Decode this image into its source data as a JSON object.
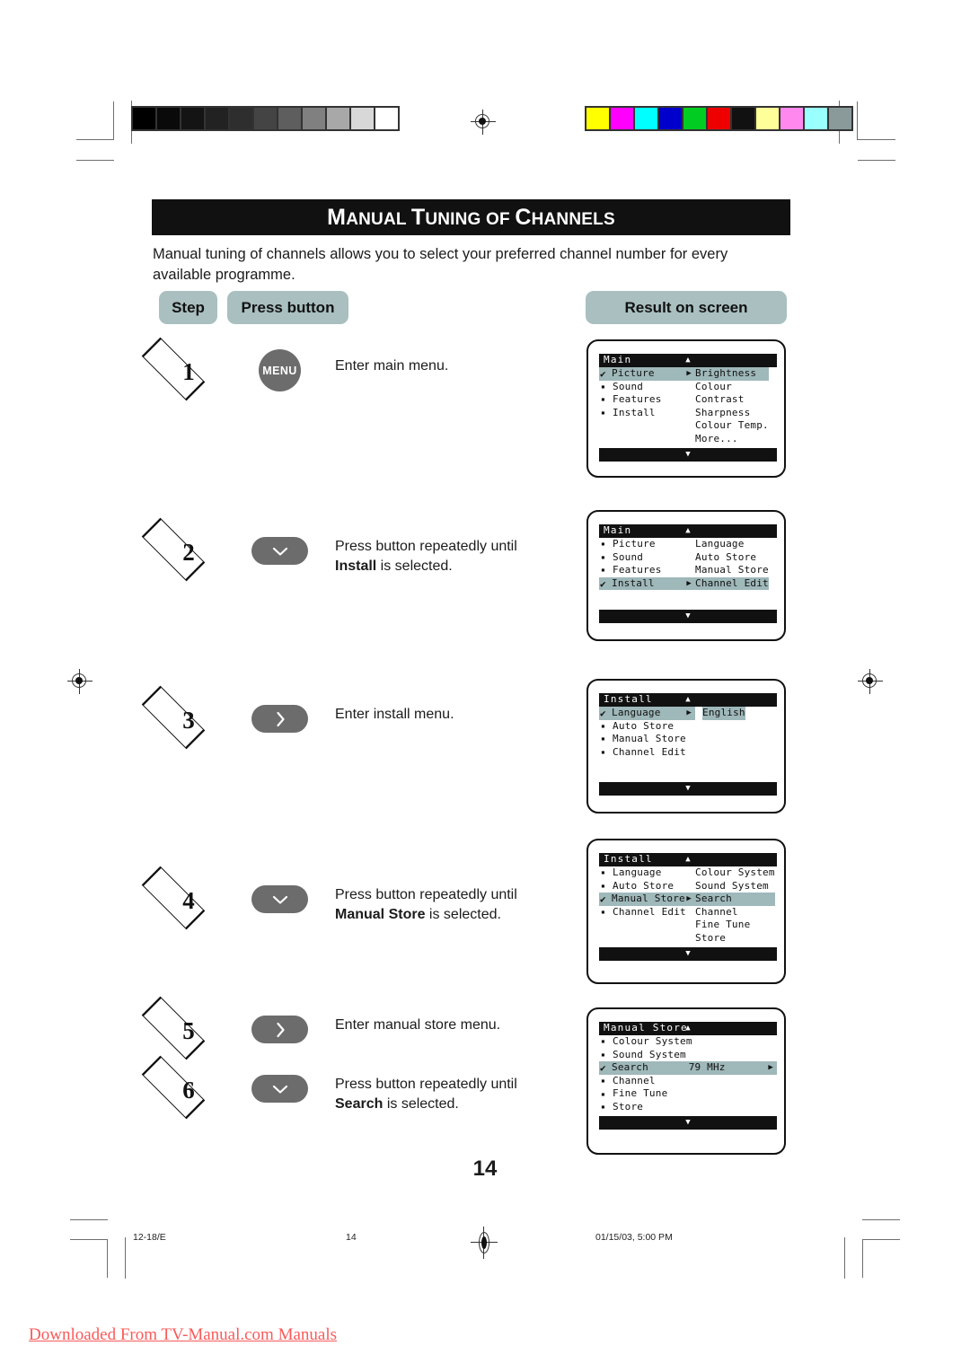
{
  "document": {
    "title_parts": [
      {
        "big": "M",
        "small": "ANUAL"
      },
      {
        "big": "T",
        "small": "UNING"
      },
      {
        "big": "",
        "small": "OF"
      },
      {
        "big": "C",
        "small": "HANNELS"
      }
    ],
    "title_text": "MANUAL TUNING OF CHANNELS",
    "intro": "Manual tuning of channels allows you to select your preferred channel number for every available programme.",
    "page_number": "14"
  },
  "headers": {
    "step": "Step",
    "press_button": "Press button",
    "result_on_screen": "Result on screen",
    "pill_color": "#a9bfc0"
  },
  "steps": [
    {
      "number": "1",
      "button": {
        "type": "round",
        "label": "MENU",
        "icon": "menu-button"
      },
      "text_plain": "Enter main menu.",
      "text_bold": "",
      "text_tail": ""
    },
    {
      "number": "2",
      "button": {
        "type": "pill",
        "label": "",
        "icon": "chevron-down-icon"
      },
      "text_plain": "Press button repeatedly until ",
      "text_bold": "Install",
      "text_tail": " is selected."
    },
    {
      "number": "3",
      "button": {
        "type": "pill",
        "label": "",
        "icon": "chevron-right-icon"
      },
      "text_plain": "Enter install menu.",
      "text_bold": "",
      "text_tail": ""
    },
    {
      "number": "4",
      "button": {
        "type": "pill",
        "label": "",
        "icon": "chevron-down-icon"
      },
      "text_plain": "Press button repeatedly until ",
      "text_bold": "Manual Store",
      "text_tail": " is selected."
    },
    {
      "number": "5",
      "button": {
        "type": "pill",
        "label": "",
        "icon": "chevron-right-icon"
      },
      "text_plain": "Enter manual store menu.",
      "text_bold": "",
      "text_tail": ""
    },
    {
      "number": "6",
      "button": {
        "type": "pill",
        "label": "",
        "icon": "chevron-down-icon"
      },
      "text_plain": "Press button repeatedly until ",
      "text_bold": "Search",
      "text_tail": " is selected."
    }
  ],
  "screens": [
    {
      "title": "Main",
      "up_arrow": "▲",
      "down_arrow": "▼",
      "left_items": [
        {
          "marker": "check",
          "label": "Picture",
          "selected": true,
          "arrow": "▶"
        },
        {
          "marker": "square",
          "label": "Sound",
          "selected": false,
          "arrow": ""
        },
        {
          "marker": "square",
          "label": "Features",
          "selected": false,
          "arrow": ""
        },
        {
          "marker": "square",
          "label": "Install",
          "selected": false,
          "arrow": ""
        }
      ],
      "right_items": [
        {
          "label": "Brightness",
          "selected": true
        },
        {
          "label": "Colour",
          "selected": false
        },
        {
          "label": "Contrast",
          "selected": false
        },
        {
          "label": "Sharpness",
          "selected": false
        },
        {
          "label": "Colour Temp.",
          "selected": false
        },
        {
          "label": "More...",
          "selected": false
        }
      ]
    },
    {
      "title": "Main",
      "up_arrow": "▲",
      "down_arrow": "▼",
      "left_items": [
        {
          "marker": "square",
          "label": "Picture",
          "selected": false,
          "arrow": ""
        },
        {
          "marker": "square",
          "label": "Sound",
          "selected": false,
          "arrow": ""
        },
        {
          "marker": "square",
          "label": "Features",
          "selected": false,
          "arrow": ""
        },
        {
          "marker": "check",
          "label": "Install",
          "selected": true,
          "arrow": "▶"
        }
      ],
      "right_items": [
        {
          "label": "Language",
          "selected": false
        },
        {
          "label": "Auto Store",
          "selected": false
        },
        {
          "label": "Manual Store",
          "selected": false
        },
        {
          "label": "Channel Edit",
          "selected": true
        }
      ]
    },
    {
      "title": "Install",
      "up_arrow": "▲",
      "down_arrow": "▼",
      "left_items": [
        {
          "marker": "check",
          "label": "Language",
          "selected": true,
          "arrow": "▶"
        },
        {
          "marker": "square",
          "label": "Auto Store",
          "selected": false,
          "arrow": ""
        },
        {
          "marker": "square",
          "label": "Manual Store",
          "selected": false,
          "arrow": ""
        },
        {
          "marker": "square",
          "label": "Channel Edit",
          "selected": false,
          "arrow": ""
        }
      ],
      "right_items": [
        {
          "label": "English",
          "selected": true
        }
      ]
    },
    {
      "title": "Install",
      "up_arrow": "▲",
      "down_arrow": "▼",
      "left_items": [
        {
          "marker": "square",
          "label": "Language",
          "selected": false,
          "arrow": ""
        },
        {
          "marker": "square",
          "label": "Auto Store",
          "selected": false,
          "arrow": ""
        },
        {
          "marker": "check",
          "label": "Manual Store",
          "selected": true,
          "arrow": "▶"
        },
        {
          "marker": "square",
          "label": "Channel Edit",
          "selected": false,
          "arrow": ""
        }
      ],
      "right_items": [
        {
          "label": "Colour System",
          "selected": false
        },
        {
          "label": "Sound System",
          "selected": false
        },
        {
          "label": "Search",
          "selected": true
        },
        {
          "label": "Channel",
          "selected": false
        },
        {
          "label": "Fine Tune",
          "selected": false
        },
        {
          "label": "Store",
          "selected": false
        }
      ]
    },
    {
      "title": "Manual Store",
      "up_arrow": "▲",
      "down_arrow": "▼",
      "left_items": [
        {
          "marker": "square",
          "label": "Colour System",
          "selected": false,
          "arrow": "",
          "value": ""
        },
        {
          "marker": "square",
          "label": "Sound System",
          "selected": false,
          "arrow": "",
          "value": ""
        },
        {
          "marker": "check",
          "label": "Search",
          "selected": true,
          "arrow": "▶",
          "value": "79 MHz"
        },
        {
          "marker": "square",
          "label": "Channel",
          "selected": false,
          "arrow": "",
          "value": ""
        },
        {
          "marker": "square",
          "label": "Fine Tune",
          "selected": false,
          "arrow": "",
          "value": ""
        },
        {
          "marker": "square",
          "label": "Store",
          "selected": false,
          "arrow": "",
          "value": ""
        }
      ],
      "right_items": []
    }
  ],
  "footer": {
    "left": "12-18/E",
    "center": "14",
    "right": "01/15/03, 5:00 PM"
  },
  "watermark": "Downloaded From TV-Manual.com Manuals",
  "calibration": {
    "grayscale": [
      "#000000",
      "#0a0a0a",
      "#141414",
      "#222222",
      "#2e2e2e",
      "#444444",
      "#5e5e5e",
      "#808080",
      "#a8a8a8",
      "#d8d8d8",
      "#ffffff"
    ],
    "colors": [
      "#ffff00",
      "#ff00ff",
      "#00ffff",
      "#0000cc",
      "#00cc22",
      "#ee0000",
      "#111111",
      "#ffff99",
      "#ff88ee",
      "#99ffff",
      "#8a9a9a"
    ]
  }
}
